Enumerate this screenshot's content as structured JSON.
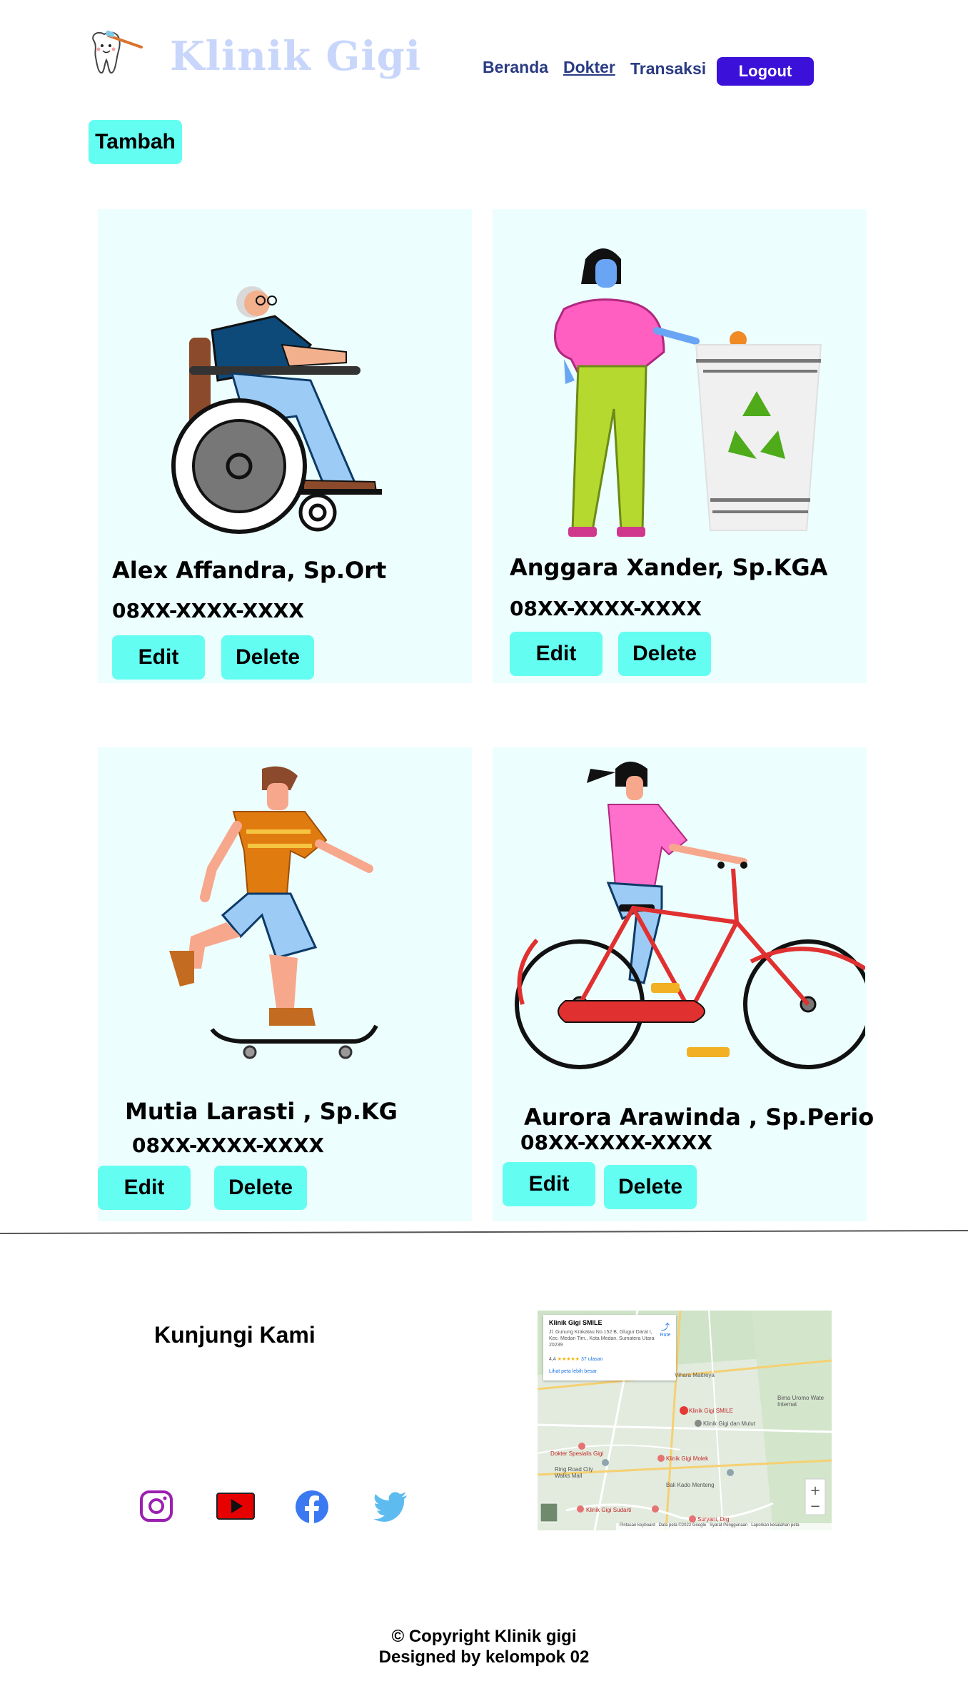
{
  "header": {
    "brand": "Klinik Gigi",
    "nav": {
      "beranda": "Beranda",
      "dokter": "Dokter",
      "transaksi": "Transaksi"
    },
    "logout_label": "Logout"
  },
  "actions": {
    "tambah_label": "Tambah"
  },
  "doctors": [
    {
      "name": "Alex Affandra, Sp.Ort",
      "phone": "08XX-XXXX-XXXX",
      "edit_label": "Edit",
      "delete_label": "Delete"
    },
    {
      "name": "Anggara Xander, Sp.KGA",
      "phone": "08XX-XXXX-XXXX",
      "edit_label": "Edit",
      "delete_label": "Delete"
    },
    {
      "name": "Mutia Larasti , Sp.KG",
      "phone": "08XX-XXXX-XXXX",
      "edit_label": "Edit",
      "delete_label": "Delete"
    },
    {
      "name": "Aurora Arawinda , Sp.Perio",
      "phone": "08XX-XXXX-XXXX",
      "edit_label": "Edit",
      "delete_label": "Delete"
    }
  ],
  "footer": {
    "heading": "Kunjungi Kami",
    "social_icons": [
      "instagram-icon",
      "youtube-icon",
      "facebook-icon",
      "twitter-icon"
    ],
    "map": {
      "place_name": "Klinik Gigi SMILE",
      "address": "Jl. Gunung Krakatau No.152 B, Glugur Darat I, Kec. Medan Tim., Kota Medan, Sumatera Utara 20239",
      "rating": "4,4",
      "reviews": "37 ulasan",
      "directions": "Rute",
      "larger_map": "Lihat peta lebih besar",
      "labels": [
        "Vihara Maitreya",
        "Klinik Gigi SMILE",
        "Klinik Gigi dan Mulut",
        "Dokter Spesialis Gigi",
        "Ring Road City Walks Mall",
        "Klinik Gigi Molek",
        "Bali Kado Menteng",
        "Klinik Gigi Sudarti",
        "Bima Uromo Wate Internat",
        "Suryani, Drg"
      ],
      "attribution": "Pintasan keyboard   Data peta ©2022 Google   Syarat Penggunaan   Laporkan kesalahan peta"
    },
    "copyright": "© Copyright Klinik gigi",
    "designed_by": "Designed by kelompok 02"
  },
  "colors": {
    "accent_cyan": "#64fdf2",
    "logout_bg": "#3b10d8",
    "nav_text": "#2a3b83",
    "brand_text": "#c9d6fb",
    "card_bg": "#ecfefd"
  }
}
